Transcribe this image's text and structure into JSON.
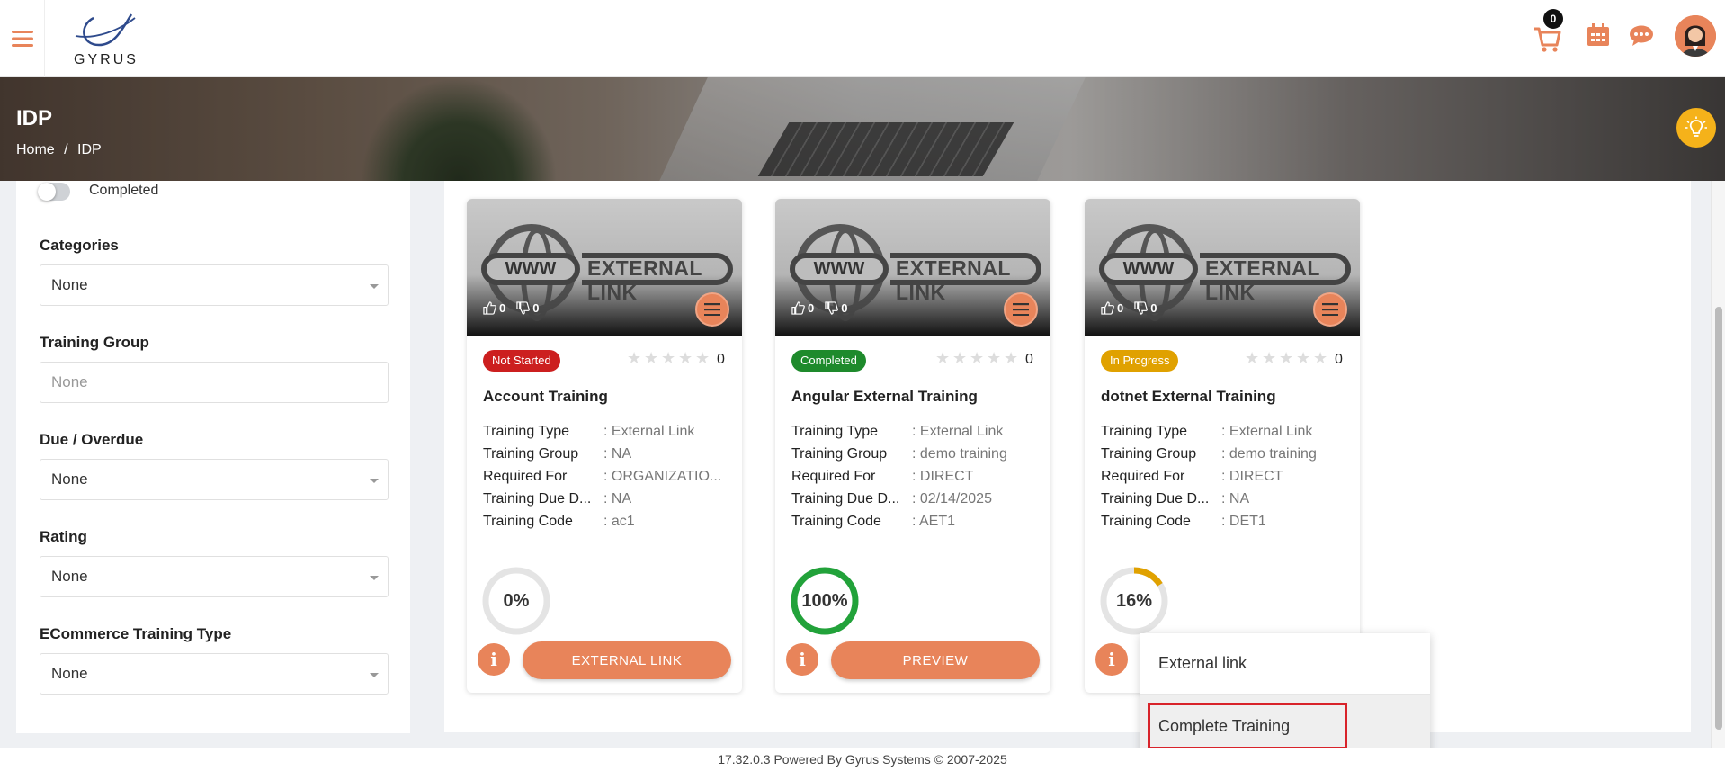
{
  "header": {
    "logo_text": "GYRUS",
    "cart_count": "0"
  },
  "banner": {
    "title": "IDP",
    "breadcrumb": [
      "Home",
      "/",
      "IDP"
    ]
  },
  "sidebar": {
    "completed_toggle_label": "Completed",
    "filters": [
      {
        "label": "Categories",
        "value": "None"
      },
      {
        "label": "Training Group",
        "placeholder": "None"
      },
      {
        "label": "Due / Overdue",
        "value": "None"
      },
      {
        "label": "Rating",
        "value": "None"
      },
      {
        "label": "ECommerce Training Type",
        "value": "None"
      }
    ]
  },
  "cards": [
    {
      "likes": "0",
      "dislikes": "0",
      "status": "Not Started",
      "status_color": "#cc1f1f",
      "rating_count": "0",
      "title": "Account Training",
      "fields": [
        {
          "k": "Training Type",
          "v": ": External Link"
        },
        {
          "k": "Training Group",
          "v": ": NA"
        },
        {
          "k": "Required For",
          "v": ": ORGANIZATIO..."
        },
        {
          "k": "Training Due D...",
          "v": ": NA"
        },
        {
          "k": "Training Code",
          "v": ":  ac1"
        }
      ],
      "progress_label": "0%",
      "progress": 0,
      "progress_color": "#e0e0e0",
      "action": "EXTERNAL LINK"
    },
    {
      "likes": "0",
      "dislikes": "0",
      "status": "Completed",
      "status_color": "#1e8a2c",
      "rating_count": "0",
      "title": "Angular External Training",
      "fields": [
        {
          "k": "Training Type",
          "v": ": External Link"
        },
        {
          "k": "Training Group",
          "v": ": demo training"
        },
        {
          "k": "Required For",
          "v": ": DIRECT"
        },
        {
          "k": "Training Due D...",
          "v": ": 02/14/2025"
        },
        {
          "k": "Training Code",
          "v": ":  AET1"
        }
      ],
      "progress_label": "100%",
      "progress": 100,
      "progress_color": "#22a23a",
      "action": "PREVIEW"
    },
    {
      "likes": "0",
      "dislikes": "0",
      "status": "In Progress",
      "status_color": "#e0a100",
      "rating_count": "0",
      "title": "dotnet External Training",
      "fields": [
        {
          "k": "Training Type",
          "v": ": External Link"
        },
        {
          "k": "Training Group",
          "v": ": demo training"
        },
        {
          "k": "Required For",
          "v": ": DIRECT"
        },
        {
          "k": "Training Due D...",
          "v": ": NA"
        },
        {
          "k": "Training Code",
          "v": ":  DET1"
        }
      ],
      "progress_label": "16%",
      "progress": 16,
      "progress_color": "#e0a100",
      "action": ""
    }
  ],
  "thumbnail_text": {
    "www": "WWW",
    "label": "EXTERNAL LINK"
  },
  "dropdown": {
    "items": [
      "External link",
      "Complete Training"
    ]
  },
  "footer": {
    "text": "17.32.0.3 Powered By Gyrus Systems © 2007-2025"
  },
  "colors": {
    "accent": "#e8845a",
    "bulb": "#f5b21a"
  }
}
